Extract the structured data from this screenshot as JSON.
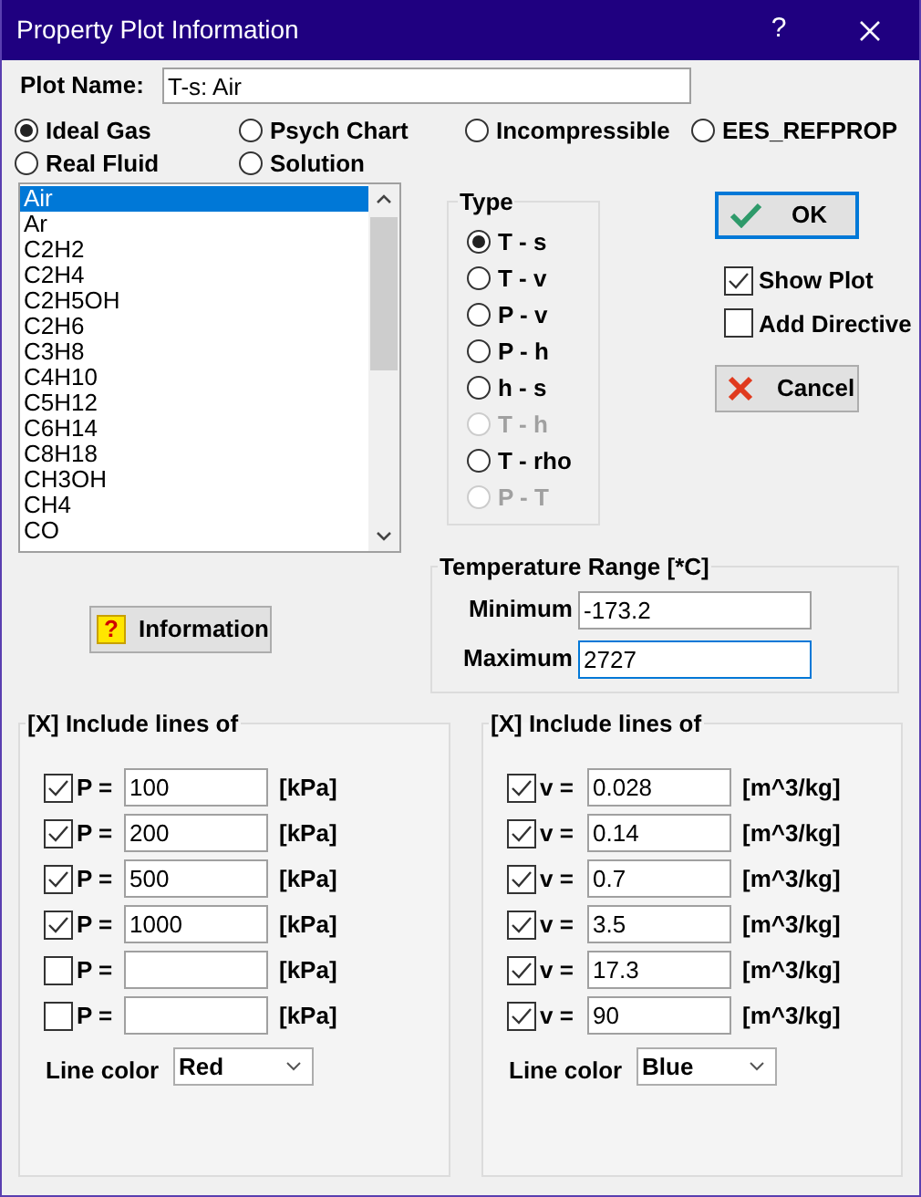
{
  "window": {
    "title": "Property Plot Information",
    "help": "?"
  },
  "plot_name": {
    "label": "Plot Name:",
    "value": "T-s: Air"
  },
  "substance_types": [
    {
      "label": "Ideal Gas",
      "selected": true
    },
    {
      "label": "Psych Chart",
      "selected": false
    },
    {
      "label": "Incompressible",
      "selected": false
    },
    {
      "label": "EES_REFPROP",
      "selected": false
    },
    {
      "label": "Real Fluid",
      "selected": false
    },
    {
      "label": "Solution",
      "selected": false
    }
  ],
  "substances": [
    {
      "label": "Air",
      "selected": true
    },
    {
      "label": "Ar",
      "selected": false
    },
    {
      "label": "C2H2",
      "selected": false
    },
    {
      "label": "C2H4",
      "selected": false
    },
    {
      "label": "C2H5OH",
      "selected": false
    },
    {
      "label": "C2H6",
      "selected": false
    },
    {
      "label": "C3H8",
      "selected": false
    },
    {
      "label": "C4H10",
      "selected": false
    },
    {
      "label": "C5H12",
      "selected": false
    },
    {
      "label": "C6H14",
      "selected": false
    },
    {
      "label": "C8H18",
      "selected": false
    },
    {
      "label": "CH3OH",
      "selected": false
    },
    {
      "label": "CH4",
      "selected": false
    },
    {
      "label": "CO",
      "selected": false
    }
  ],
  "information_icon": "?",
  "information_button": "Information",
  "type": {
    "title": "Type",
    "options": [
      {
        "label": "T - s",
        "selected": true,
        "disabled": false
      },
      {
        "label": "T - v",
        "selected": false,
        "disabled": false
      },
      {
        "label": "P - v",
        "selected": false,
        "disabled": false
      },
      {
        "label": "P - h",
        "selected": false,
        "disabled": false
      },
      {
        "label": "h - s",
        "selected": false,
        "disabled": false
      },
      {
        "label": "T - h",
        "selected": false,
        "disabled": true
      },
      {
        "label": "T - rho",
        "selected": false,
        "disabled": false
      },
      {
        "label": "P - T",
        "selected": false,
        "disabled": true
      }
    ]
  },
  "ok_button": "OK",
  "options": [
    {
      "label": "Show Plot",
      "checked": true
    },
    {
      "label": "Add Directive",
      "checked": false
    }
  ],
  "cancel_button": "Cancel",
  "temperature_range": {
    "title": "Temperature Range [*C]",
    "fields": [
      {
        "label": "Minimum",
        "value": "-173.2",
        "focused": false
      },
      {
        "label": "Maximum",
        "value": "2727",
        "focused": true
      }
    ]
  },
  "line_groups": [
    {
      "title": "[X] Include lines of",
      "line_color_label": "Line color",
      "line_color": "Red",
      "lines": [
        {
          "label": "P =",
          "checked": true,
          "value": "100",
          "unit": "[kPa]"
        },
        {
          "label": "P =",
          "checked": true,
          "value": "200",
          "unit": "[kPa]"
        },
        {
          "label": "P =",
          "checked": true,
          "value": "500",
          "unit": "[kPa]"
        },
        {
          "label": "P =",
          "checked": true,
          "value": "1000",
          "unit": "[kPa]"
        },
        {
          "label": "P =",
          "checked": false,
          "unit": "[kPa]"
        },
        {
          "label": "P =",
          "checked": false,
          "unit": "[kPa]"
        }
      ]
    },
    {
      "title": "[X] Include lines of",
      "line_color_label": "Line color",
      "line_color": "Blue",
      "lines": [
        {
          "label": "v =",
          "checked": true,
          "value": "0.028",
          "unit": "[m^3/kg]"
        },
        {
          "label": "v =",
          "checked": true,
          "value": "0.14",
          "unit": "[m^3/kg]"
        },
        {
          "label": "v =",
          "checked": true,
          "value": "0.7",
          "unit": "[m^3/kg]"
        },
        {
          "label": "v =",
          "checked": true,
          "value": "3.5",
          "unit": "[m^3/kg]"
        },
        {
          "label": "v =",
          "checked": true,
          "value": "17.3",
          "unit": "[m^3/kg]"
        },
        {
          "label": "v =",
          "checked": true,
          "value": "90",
          "unit": "[m^3/kg]"
        }
      ]
    }
  ]
}
